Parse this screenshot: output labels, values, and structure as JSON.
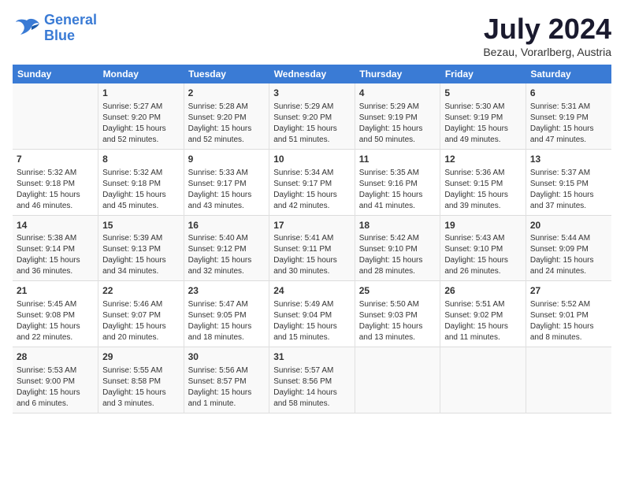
{
  "logo": {
    "line1": "General",
    "line2": "Blue"
  },
  "header": {
    "month": "July 2024",
    "location": "Bezau, Vorarlberg, Austria"
  },
  "weekdays": [
    "Sunday",
    "Monday",
    "Tuesday",
    "Wednesday",
    "Thursday",
    "Friday",
    "Saturday"
  ],
  "weeks": [
    [
      {
        "day": "",
        "sunrise": "",
        "sunset": "",
        "daylight": ""
      },
      {
        "day": "1",
        "sunrise": "Sunrise: 5:27 AM",
        "sunset": "Sunset: 9:20 PM",
        "daylight": "Daylight: 15 hours and 52 minutes."
      },
      {
        "day": "2",
        "sunrise": "Sunrise: 5:28 AM",
        "sunset": "Sunset: 9:20 PM",
        "daylight": "Daylight: 15 hours and 52 minutes."
      },
      {
        "day": "3",
        "sunrise": "Sunrise: 5:29 AM",
        "sunset": "Sunset: 9:20 PM",
        "daylight": "Daylight: 15 hours and 51 minutes."
      },
      {
        "day": "4",
        "sunrise": "Sunrise: 5:29 AM",
        "sunset": "Sunset: 9:19 PM",
        "daylight": "Daylight: 15 hours and 50 minutes."
      },
      {
        "day": "5",
        "sunrise": "Sunrise: 5:30 AM",
        "sunset": "Sunset: 9:19 PM",
        "daylight": "Daylight: 15 hours and 49 minutes."
      },
      {
        "day": "6",
        "sunrise": "Sunrise: 5:31 AM",
        "sunset": "Sunset: 9:19 PM",
        "daylight": "Daylight: 15 hours and 47 minutes."
      }
    ],
    [
      {
        "day": "7",
        "sunrise": "Sunrise: 5:32 AM",
        "sunset": "Sunset: 9:18 PM",
        "daylight": "Daylight: 15 hours and 46 minutes."
      },
      {
        "day": "8",
        "sunrise": "Sunrise: 5:32 AM",
        "sunset": "Sunset: 9:18 PM",
        "daylight": "Daylight: 15 hours and 45 minutes."
      },
      {
        "day": "9",
        "sunrise": "Sunrise: 5:33 AM",
        "sunset": "Sunset: 9:17 PM",
        "daylight": "Daylight: 15 hours and 43 minutes."
      },
      {
        "day": "10",
        "sunrise": "Sunrise: 5:34 AM",
        "sunset": "Sunset: 9:17 PM",
        "daylight": "Daylight: 15 hours and 42 minutes."
      },
      {
        "day": "11",
        "sunrise": "Sunrise: 5:35 AM",
        "sunset": "Sunset: 9:16 PM",
        "daylight": "Daylight: 15 hours and 41 minutes."
      },
      {
        "day": "12",
        "sunrise": "Sunrise: 5:36 AM",
        "sunset": "Sunset: 9:15 PM",
        "daylight": "Daylight: 15 hours and 39 minutes."
      },
      {
        "day": "13",
        "sunrise": "Sunrise: 5:37 AM",
        "sunset": "Sunset: 9:15 PM",
        "daylight": "Daylight: 15 hours and 37 minutes."
      }
    ],
    [
      {
        "day": "14",
        "sunrise": "Sunrise: 5:38 AM",
        "sunset": "Sunset: 9:14 PM",
        "daylight": "Daylight: 15 hours and 36 minutes."
      },
      {
        "day": "15",
        "sunrise": "Sunrise: 5:39 AM",
        "sunset": "Sunset: 9:13 PM",
        "daylight": "Daylight: 15 hours and 34 minutes."
      },
      {
        "day": "16",
        "sunrise": "Sunrise: 5:40 AM",
        "sunset": "Sunset: 9:12 PM",
        "daylight": "Daylight: 15 hours and 32 minutes."
      },
      {
        "day": "17",
        "sunrise": "Sunrise: 5:41 AM",
        "sunset": "Sunset: 9:11 PM",
        "daylight": "Daylight: 15 hours and 30 minutes."
      },
      {
        "day": "18",
        "sunrise": "Sunrise: 5:42 AM",
        "sunset": "Sunset: 9:10 PM",
        "daylight": "Daylight: 15 hours and 28 minutes."
      },
      {
        "day": "19",
        "sunrise": "Sunrise: 5:43 AM",
        "sunset": "Sunset: 9:10 PM",
        "daylight": "Daylight: 15 hours and 26 minutes."
      },
      {
        "day": "20",
        "sunrise": "Sunrise: 5:44 AM",
        "sunset": "Sunset: 9:09 PM",
        "daylight": "Daylight: 15 hours and 24 minutes."
      }
    ],
    [
      {
        "day": "21",
        "sunrise": "Sunrise: 5:45 AM",
        "sunset": "Sunset: 9:08 PM",
        "daylight": "Daylight: 15 hours and 22 minutes."
      },
      {
        "day": "22",
        "sunrise": "Sunrise: 5:46 AM",
        "sunset": "Sunset: 9:07 PM",
        "daylight": "Daylight: 15 hours and 20 minutes."
      },
      {
        "day": "23",
        "sunrise": "Sunrise: 5:47 AM",
        "sunset": "Sunset: 9:05 PM",
        "daylight": "Daylight: 15 hours and 18 minutes."
      },
      {
        "day": "24",
        "sunrise": "Sunrise: 5:49 AM",
        "sunset": "Sunset: 9:04 PM",
        "daylight": "Daylight: 15 hours and 15 minutes."
      },
      {
        "day": "25",
        "sunrise": "Sunrise: 5:50 AM",
        "sunset": "Sunset: 9:03 PM",
        "daylight": "Daylight: 15 hours and 13 minutes."
      },
      {
        "day": "26",
        "sunrise": "Sunrise: 5:51 AM",
        "sunset": "Sunset: 9:02 PM",
        "daylight": "Daylight: 15 hours and 11 minutes."
      },
      {
        "day": "27",
        "sunrise": "Sunrise: 5:52 AM",
        "sunset": "Sunset: 9:01 PM",
        "daylight": "Daylight: 15 hours and 8 minutes."
      }
    ],
    [
      {
        "day": "28",
        "sunrise": "Sunrise: 5:53 AM",
        "sunset": "Sunset: 9:00 PM",
        "daylight": "Daylight: 15 hours and 6 minutes."
      },
      {
        "day": "29",
        "sunrise": "Sunrise: 5:55 AM",
        "sunset": "Sunset: 8:58 PM",
        "daylight": "Daylight: 15 hours and 3 minutes."
      },
      {
        "day": "30",
        "sunrise": "Sunrise: 5:56 AM",
        "sunset": "Sunset: 8:57 PM",
        "daylight": "Daylight: 15 hours and 1 minute."
      },
      {
        "day": "31",
        "sunrise": "Sunrise: 5:57 AM",
        "sunset": "Sunset: 8:56 PM",
        "daylight": "Daylight: 14 hours and 58 minutes."
      },
      {
        "day": "",
        "sunrise": "",
        "sunset": "",
        "daylight": ""
      },
      {
        "day": "",
        "sunrise": "",
        "sunset": "",
        "daylight": ""
      },
      {
        "day": "",
        "sunrise": "",
        "sunset": "",
        "daylight": ""
      }
    ]
  ]
}
